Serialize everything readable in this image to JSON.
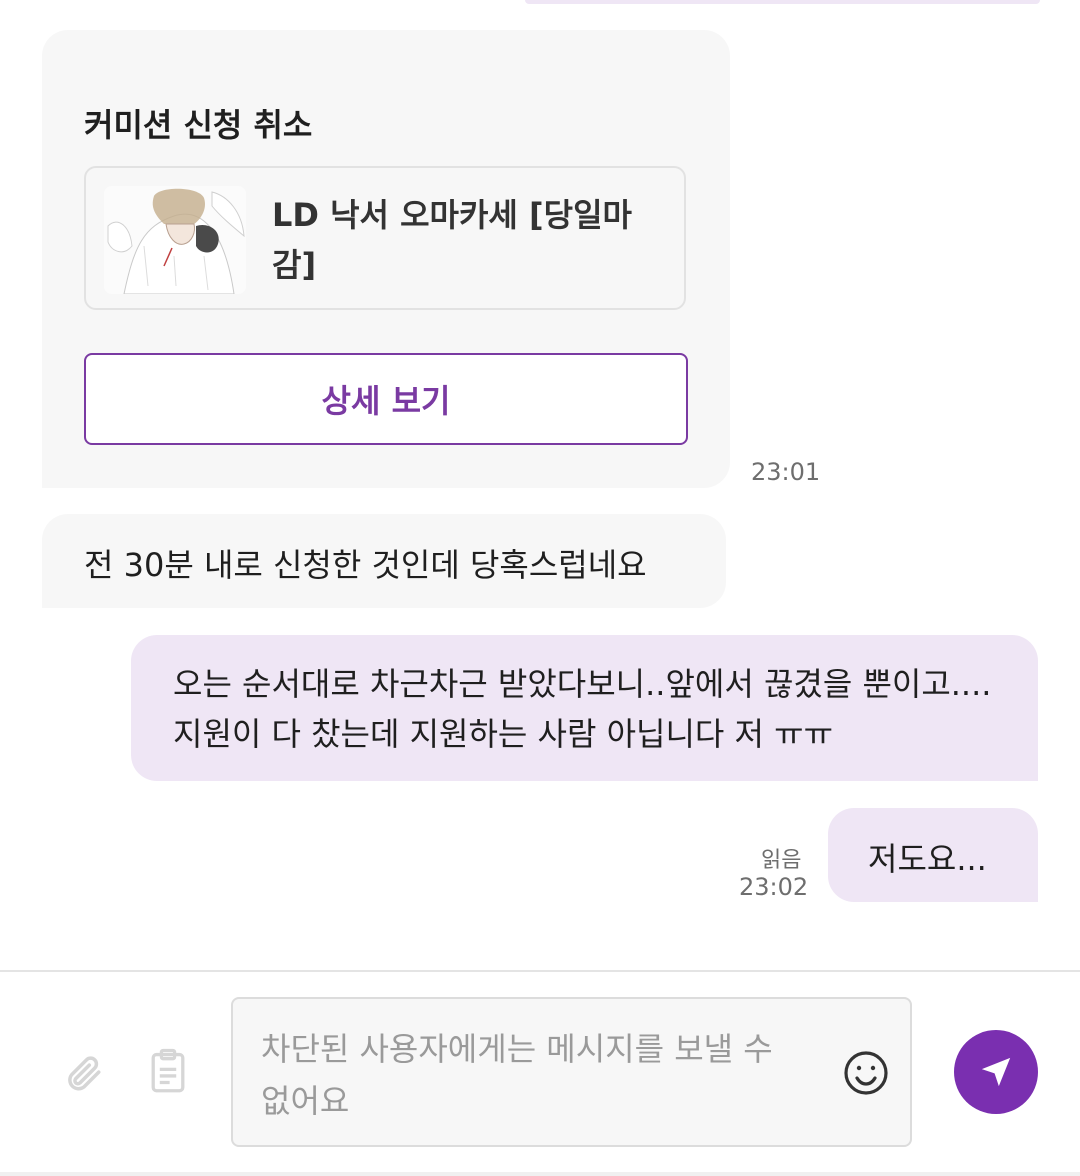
{
  "card": {
    "title": "커미션 신청 취소",
    "product_title": "LD 낙서 오마카세 [당일마감]",
    "detail_button": "상세 보기",
    "time": "23:01"
  },
  "messages": [
    {
      "direction": "incoming",
      "text": "전 30분 내로 신청한 것인데 당혹스럽네요"
    },
    {
      "direction": "outgoing",
      "text": "오는 순서대로 차근차근 받았다보니..앞에서 끊겼을 뿐이고.... 지원이 다 찼는데 지원하는 사람 아닙니다 저 ㅠㅠ"
    },
    {
      "direction": "outgoing",
      "text": "저도요...",
      "read_status": "읽음",
      "time": "23:02"
    }
  ],
  "composer": {
    "placeholder": "차단된 사용자에게는 메시지를 보낼 수 없어요",
    "attach_icon": "paperclip-icon",
    "clipboard_icon": "clipboard-icon",
    "emoji_icon": "smiley-icon",
    "send_icon": "send-icon"
  },
  "colors": {
    "accent": "#7a2fb0",
    "outgoing_bubble": "#efe6f5",
    "incoming_bubble": "#f7f7f7"
  }
}
